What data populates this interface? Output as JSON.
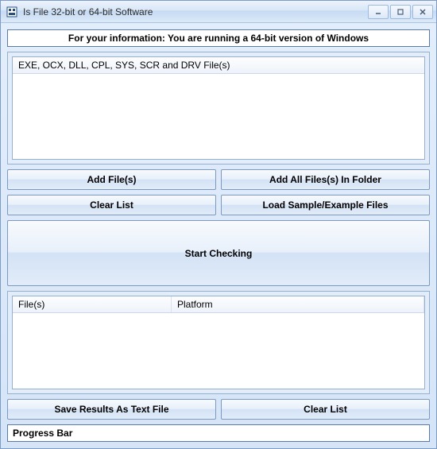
{
  "window": {
    "title": "Is File 32-bit or 64-bit Software"
  },
  "info": {
    "banner": "For your information: You are running a 64-bit version of Windows"
  },
  "input_list": {
    "header": "EXE, OCX, DLL, CPL, SYS, SCR and DRV File(s)"
  },
  "buttons": {
    "add_files": "Add File(s)",
    "add_folder": "Add All Files(s) In Folder",
    "clear_list_top": "Clear List",
    "load_sample": "Load Sample/Example Files",
    "start": "Start Checking",
    "save_results": "Save Results As Text File",
    "clear_list_bottom": "Clear List"
  },
  "results": {
    "col_files": "File(s)",
    "col_platform": "Platform"
  },
  "progress": {
    "label": "Progress Bar"
  }
}
